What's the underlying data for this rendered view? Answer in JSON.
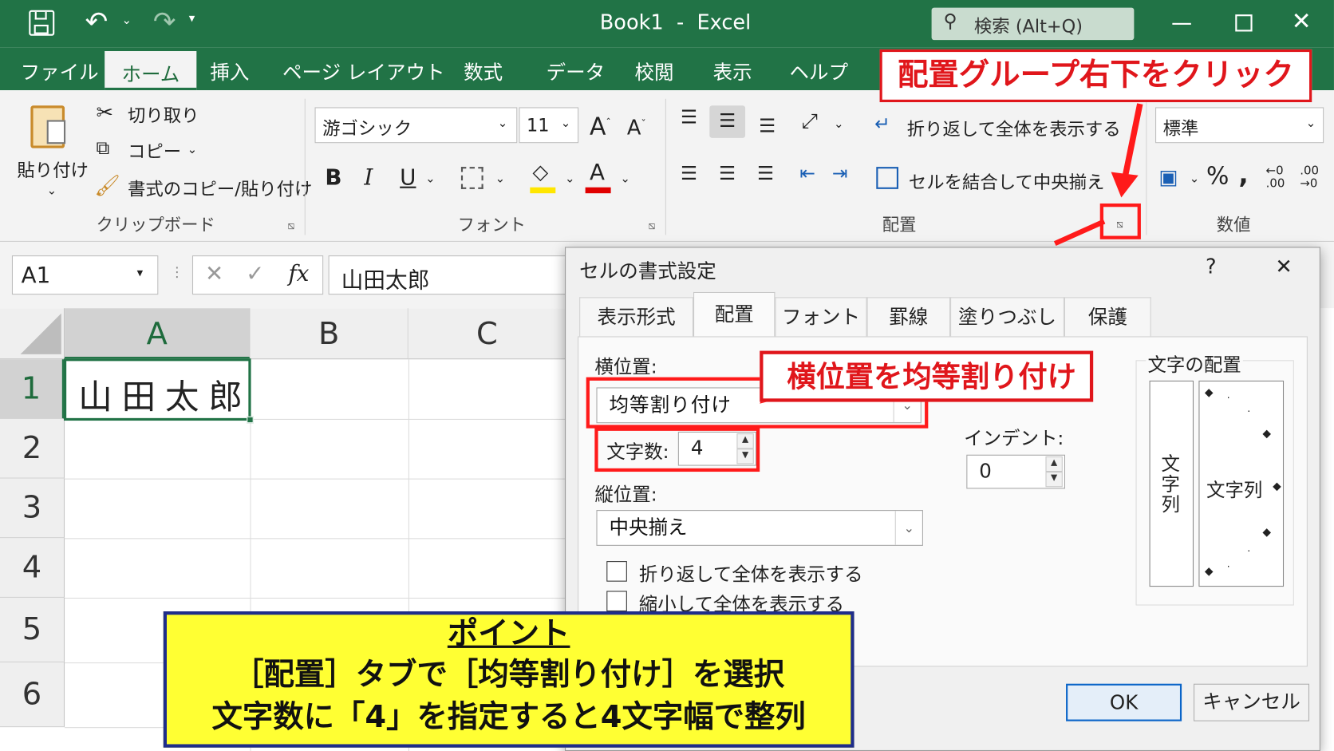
{
  "window": {
    "title": "Book1  -  Excel",
    "search_placeholder": "検索 (Alt+Q)"
  },
  "tabs": [
    "ファイル",
    "ホーム",
    "挿入",
    "ページ レイアウト",
    "数式",
    "データ",
    "校閲",
    "表示",
    "ヘルプ"
  ],
  "ribbon": {
    "clipboard": {
      "paste": "貼り付け",
      "cut": "切り取り",
      "copy": "コピー",
      "format_painter": "書式のコピー/貼り付け",
      "group": "クリップボード"
    },
    "font": {
      "name": "游ゴシック",
      "size": "11",
      "bold": "B",
      "italic": "I",
      "underline": "U",
      "group": "フォント"
    },
    "alignment": {
      "wrap": "折り返して全体を表示する",
      "merge": "セルを結合して中央揃え",
      "group": "配置"
    },
    "number": {
      "format": "標準",
      "group": "数値"
    }
  },
  "formula_bar": {
    "name_box": "A1",
    "content": "山田太郎",
    "fx": "fx"
  },
  "sheet": {
    "columns": [
      "A",
      "B",
      "C"
    ],
    "rows": [
      "1",
      "2",
      "3",
      "4",
      "5",
      "6"
    ],
    "cell_a1": "山田太郎"
  },
  "dialog": {
    "title": "セルの書式設定",
    "help": "?",
    "close": "✕",
    "tabs": [
      "表示形式",
      "配置",
      "フォント",
      "罫線",
      "塗りつぶし",
      "保護"
    ],
    "horizontal_label": "横位置:",
    "horizontal_value": "均等割り付け",
    "chars_label": "文字数:",
    "chars_value": "4",
    "indent_label": "インデント:",
    "indent_value": "0",
    "vertical_label": "縦位置:",
    "vertical_value": "中央揃え",
    "wrap_label": "折り返して全体を表示する",
    "shrink_label": "縮小して全体を表示する",
    "orientation_label": "文字の配置",
    "vertical_text": "文字列",
    "orientation_text": "文字列",
    "ok": "OK",
    "cancel": "キャンセル"
  },
  "annotations": {
    "top": "配置グループ右下をクリック",
    "middle": "横位置を均等割り付け",
    "point_title": "ポイント",
    "point_line1": "［配置］タブで［均等割り付け］を選択",
    "point_line2": "文字数に「4」を指定すると4文字幅で整列"
  },
  "colors": {
    "excel_green": "#217346",
    "annotation_red": "#e0161b",
    "note_yellow": "#ffff33",
    "note_border": "#1f2d8a"
  }
}
